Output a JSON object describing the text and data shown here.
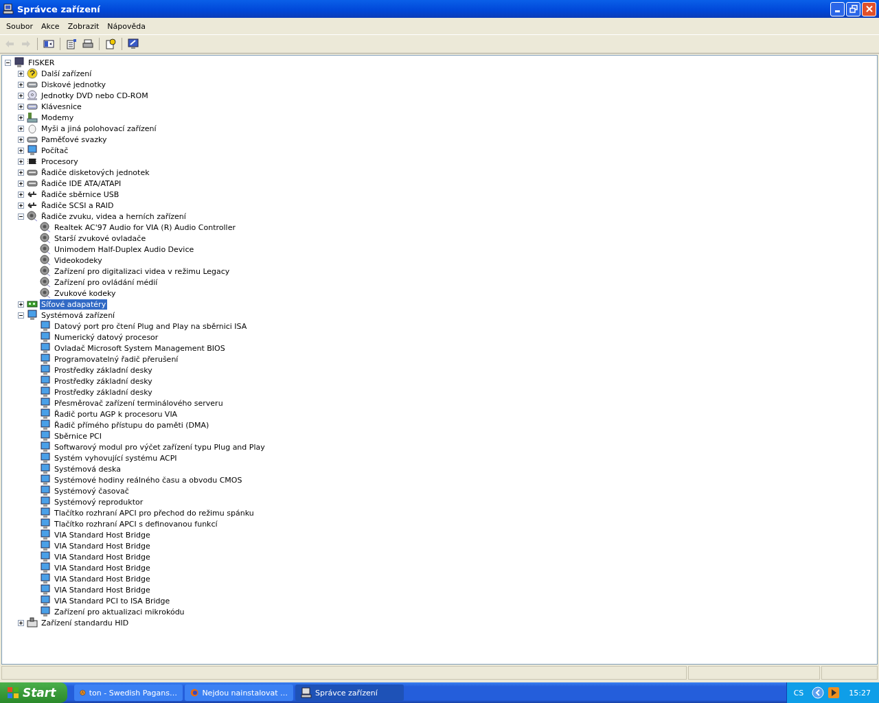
{
  "window": {
    "title": "Správce zařízení"
  },
  "menu": [
    {
      "label": "Soubor"
    },
    {
      "label": "Akce"
    },
    {
      "label": "Zobrazit"
    },
    {
      "label": "Nápověda"
    }
  ],
  "toolbar": [
    {
      "disabled": true
    },
    {
      "disabled": true
    },
    {
      "disabled": false
    },
    {
      "disabled": false
    },
    {
      "disabled": false
    },
    {
      "disabled": false
    },
    {
      "disabled": false
    }
  ],
  "tree": {
    "label": "FISKER",
    "expanded": true,
    "selected": false,
    "children": [
      {
        "label": "Další zařízení",
        "expanded": false,
        "selected": false
      },
      {
        "label": "Diskové jednotky",
        "expanded": false,
        "selected": false
      },
      {
        "label": "Jednotky DVD nebo CD-ROM",
        "expanded": false,
        "selected": false
      },
      {
        "label": "Klávesnice",
        "expanded": false,
        "selected": false
      },
      {
        "label": "Modemy",
        "expanded": false,
        "selected": false
      },
      {
        "label": "Myši a jiná polohovací zařízení",
        "expanded": false,
        "selected": false
      },
      {
        "label": "Paměťové svazky",
        "expanded": false,
        "selected": false
      },
      {
        "label": "Počítač",
        "expanded": false,
        "selected": false
      },
      {
        "label": "Procesory",
        "expanded": false,
        "selected": false
      },
      {
        "label": "Řadiče disketových jednotek",
        "expanded": false,
        "selected": false
      },
      {
        "label": "Řadiče IDE ATA/ATAPI",
        "expanded": false,
        "selected": false
      },
      {
        "label": "Řadiče sběrnice USB",
        "expanded": false,
        "selected": false
      },
      {
        "label": "Řadiče SCSI a RAID",
        "expanded": false,
        "selected": false
      },
      {
        "label": "Řadiče zvuku, videa a herních zařízení",
        "expanded": true,
        "selected": false,
        "children": [
          {
            "label": "Realtek AC'97 Audio for VIA (R) Audio Controller",
            "selected": false
          },
          {
            "label": "Starší zvukové ovladače",
            "selected": false
          },
          {
            "label": "Unimodem Half-Duplex Audio Device",
            "selected": false
          },
          {
            "label": "Videokodeky",
            "selected": false
          },
          {
            "label": "Zařízení pro digitalizaci videa v režimu Legacy",
            "selected": false
          },
          {
            "label": "Zařízení pro ovládání médií",
            "selected": false
          },
          {
            "label": "Zvukové kodeky",
            "selected": false
          }
        ]
      },
      {
        "label": "Síťové adapatéry",
        "expanded": false,
        "selected": true
      },
      {
        "label": "Systémová zařízení",
        "expanded": true,
        "selected": false,
        "children": [
          {
            "label": "Datový port pro čtení Plug and Play na sběrnici ISA",
            "selected": false
          },
          {
            "label": "Numerický datový procesor",
            "selected": false
          },
          {
            "label": "Ovladač Microsoft System Management BIOS",
            "selected": false
          },
          {
            "label": "Programovatelný řadič přerušení",
            "selected": false
          },
          {
            "label": "Prostředky základní desky",
            "selected": false
          },
          {
            "label": "Prostředky základní desky",
            "selected": false
          },
          {
            "label": "Prostředky základní desky",
            "selected": false
          },
          {
            "label": "Přesměrovač zařízení terminálového serveru",
            "selected": false
          },
          {
            "label": "Řadič portu AGP k procesoru VIA",
            "selected": false
          },
          {
            "label": "Řadič přímého přístupu do paměti (DMA)",
            "selected": false
          },
          {
            "label": "Sběrnice PCI",
            "selected": false
          },
          {
            "label": "Softwarový modul pro výčet zařízení typu Plug and Play",
            "selected": false
          },
          {
            "label": "Systém vyhovující systému ACPI",
            "selected": false
          },
          {
            "label": "Systémová deska",
            "selected": false
          },
          {
            "label": "Systémové hodiny reálného času a obvodu CMOS",
            "selected": false
          },
          {
            "label": "Systémový časovač",
            "selected": false
          },
          {
            "label": "Systémový reproduktor",
            "selected": false
          },
          {
            "label": "Tlačítko rozhraní APCI pro přechod do režimu spánku",
            "selected": false
          },
          {
            "label": "Tlačítko rozhraní APCI s definovanou funkcí",
            "selected": false
          },
          {
            "label": "VIA Standard Host Bridge",
            "selected": false
          },
          {
            "label": "VIA Standard Host Bridge",
            "selected": false
          },
          {
            "label": "VIA Standard Host Bridge",
            "selected": false
          },
          {
            "label": "VIA Standard Host Bridge",
            "selected": false
          },
          {
            "label": "VIA Standard Host Bridge",
            "selected": false
          },
          {
            "label": "VIA Standard Host Bridge",
            "selected": false
          },
          {
            "label": "VIA Standard PCI to ISA Bridge",
            "selected": false
          },
          {
            "label": "Zařízení pro aktualizaci mikrokódu",
            "selected": false
          }
        ]
      },
      {
        "label": "Zařízení standardu HID",
        "expanded": false,
        "selected": false
      }
    ]
  },
  "taskbar": {
    "start": "Start",
    "tasks": [
      {
        "label": "ton - Swedish Pagans…",
        "selected": false
      },
      {
        "label": "Nejdou nainstalovat …",
        "selected": false
      },
      {
        "label": "Správce zařízení",
        "selected": true
      }
    ],
    "language": "CS",
    "clock": "15:27"
  }
}
